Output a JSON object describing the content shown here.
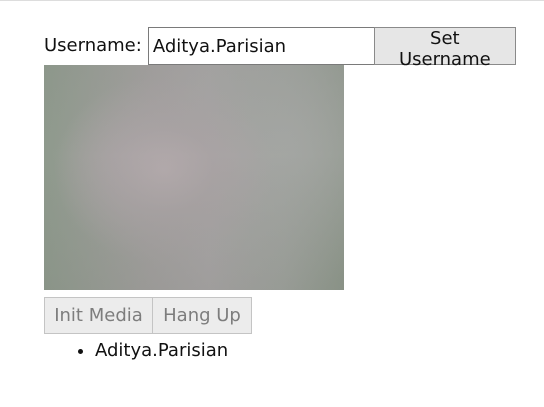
{
  "username_label": "Username:",
  "username_input": {
    "value": "Aditya.Parisian",
    "placeholder": ""
  },
  "set_username_label": "Set Username",
  "media_buttons": {
    "init_label": "Init Media",
    "hangup_label": "Hang Up"
  },
  "users": [
    "Aditya.Parisian"
  ],
  "colors": {
    "button_bg": "#e6e6e6",
    "disabled_text": "#7d7d7d",
    "video_tone": "#a9a5a6"
  }
}
